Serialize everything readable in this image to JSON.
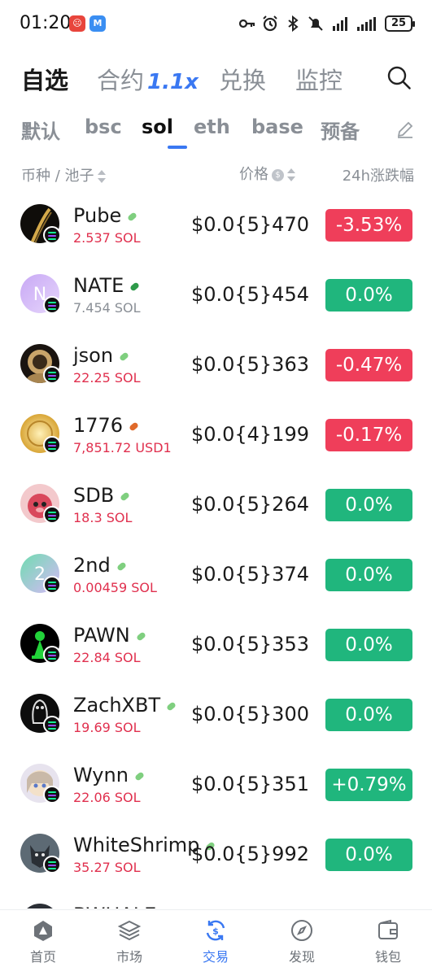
{
  "status_bar": {
    "time": "01:20",
    "battery": "25"
  },
  "top_tabs": {
    "watchlist": "自选",
    "contracts": "合约",
    "contracts_leverage": "1.1x",
    "exchange": "兑换",
    "monitor": "监控"
  },
  "chain_tabs": [
    "默认",
    "bsc",
    "sol",
    "eth",
    "base",
    "预备"
  ],
  "active_chain": "sol",
  "header": {
    "coin_pool": "币种 / 池子",
    "price": "价格",
    "price_badge": "$",
    "change": "24h涨跌幅"
  },
  "tokens": [
    {
      "name": "Pube",
      "pool": "2.537 SOL",
      "price": "$0.0{5}470",
      "change": "-3.53%",
      "direction": "down",
      "avatar": "pube-avatar"
    },
    {
      "name": "NATE",
      "pool": "7.454 SOL",
      "price": "$0.0{5}454",
      "change": "0.0%",
      "direction": "flat",
      "avatar": "letter-N",
      "avatar_letter": "N"
    },
    {
      "name": "json",
      "pool": "22.25 SOL",
      "price": "$0.0{5}363",
      "change": "-0.47%",
      "direction": "down",
      "avatar": "astronaut-avatar"
    },
    {
      "name": "1776",
      "pool": "7,851.72 USD1",
      "price": "$0.0{4}199",
      "change": "-0.17%",
      "direction": "down",
      "avatar": "gold-coin-avatar"
    },
    {
      "name": "SDB",
      "pool": "18.3 SOL",
      "price": "$0.0{5}264",
      "change": "0.0%",
      "direction": "flat",
      "avatar": "pink-dog-avatar"
    },
    {
      "name": "2nd",
      "pool": "0.00459 SOL",
      "price": "$0.0{5}374",
      "change": "0.0%",
      "direction": "flat",
      "avatar": "letter-2",
      "avatar_letter": "2"
    },
    {
      "name": "PAWN",
      "pool": "22.84 SOL",
      "price": "$0.0{5}353",
      "change": "0.0%",
      "direction": "flat",
      "avatar": "pawn-avatar"
    },
    {
      "name": "ZachXBT",
      "pool": "19.69 SOL",
      "price": "$0.0{5}300",
      "change": "0.0%",
      "direction": "flat",
      "avatar": "penguin-avatar"
    },
    {
      "name": "Wynn",
      "pool": "22.06 SOL",
      "price": "$0.0{5}351",
      "change": "+0.79%",
      "direction": "up",
      "avatar": "anime-girl-avatar"
    },
    {
      "name": "WhiteShrimp",
      "pool": "35.27 SOL",
      "price": "$0.0{5}992",
      "change": "0.0%",
      "direction": "flat",
      "avatar": "wolf-avatar"
    },
    {
      "name": "BWHALE",
      "pool": "",
      "price": "",
      "change": "",
      "direction": "flat",
      "avatar": "whale-avatar"
    }
  ],
  "bottom_nav": [
    {
      "label": "首页",
      "icon": "home-icon"
    },
    {
      "label": "市场",
      "icon": "layers-icon"
    },
    {
      "label": "交易",
      "icon": "swap-icon"
    },
    {
      "label": "发现",
      "icon": "compass-icon"
    },
    {
      "label": "钱包",
      "icon": "wallet-icon"
    }
  ],
  "colors": {
    "accent": "#3a78f2",
    "down": "#ef3e5a",
    "up": "#20b67d",
    "pool_text": "#e0304e"
  }
}
